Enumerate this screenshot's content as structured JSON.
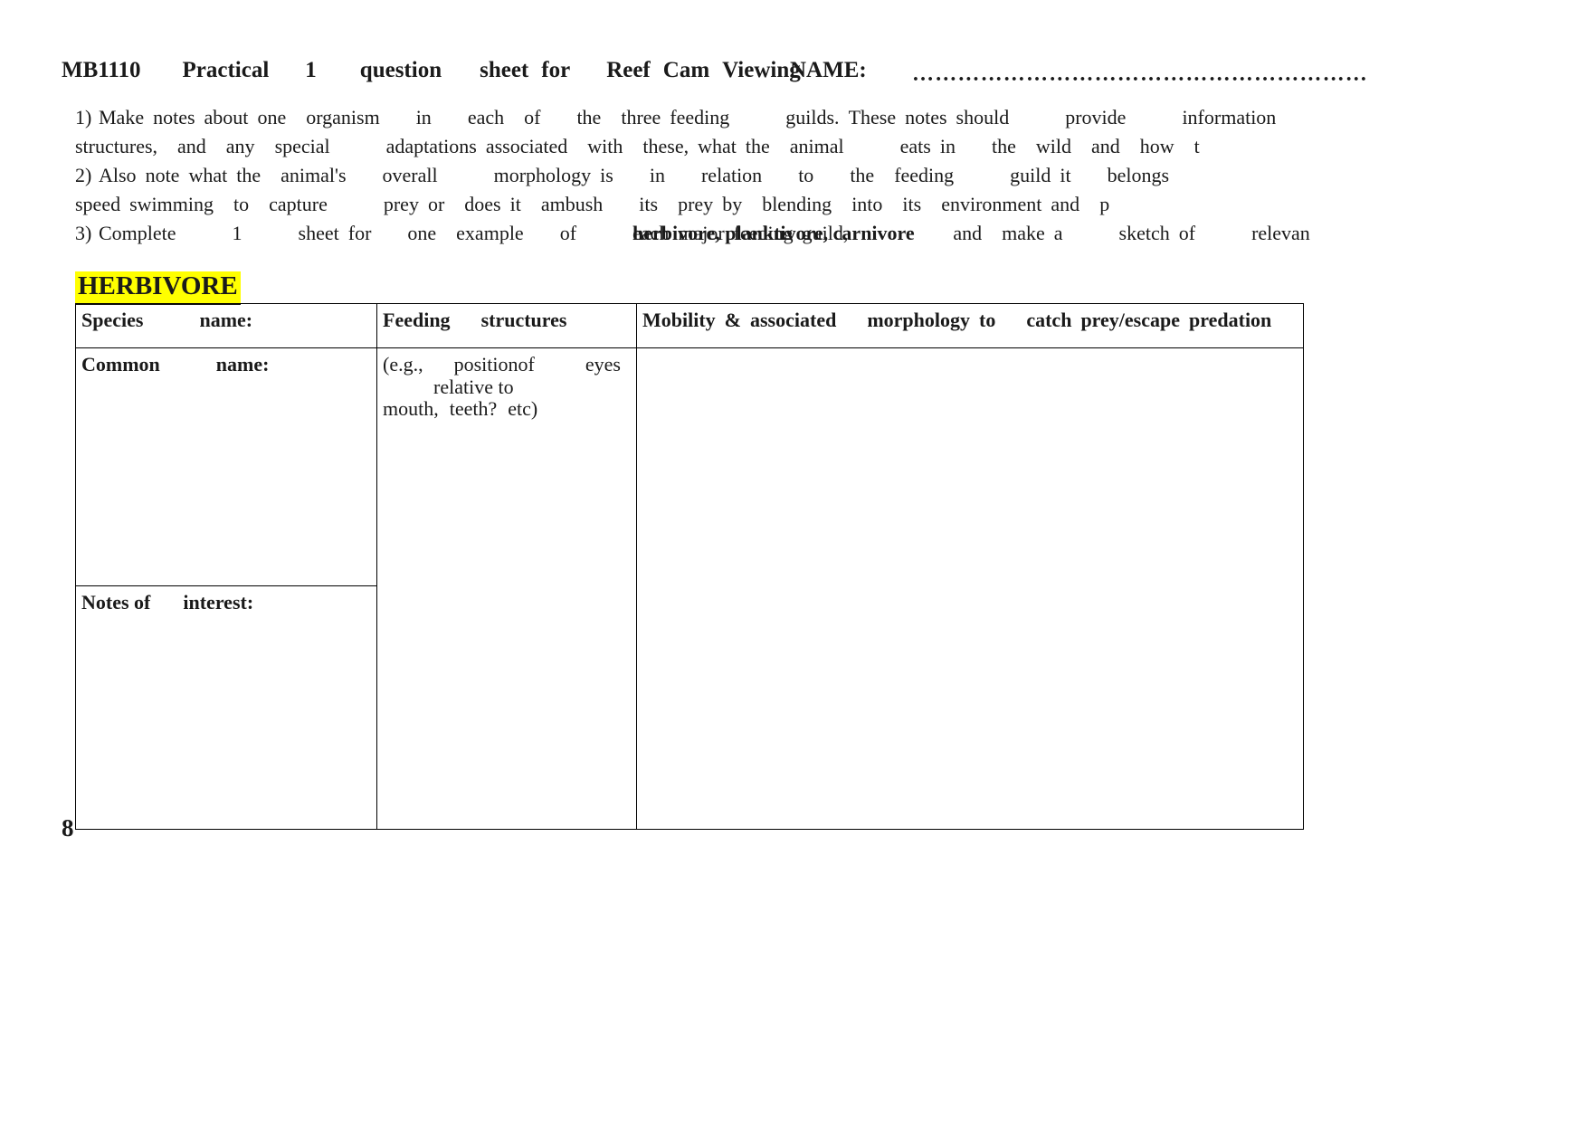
{
  "document": {
    "title_words": [
      "MB1110",
      "Practical",
      "1",
      "question",
      "sheet",
      "for",
      "Reef",
      "Cam",
      "Viewing"
    ],
    "title_full": "MB1110 Practical 1 question sheet for Reef Cam Viewing",
    "name_label": "NAME:",
    "name_dots": "……………………………………………………",
    "page_number": "8"
  },
  "instructions": {
    "item1": {
      "number": "1)",
      "line1_words": [
        "Make",
        "notes",
        "about",
        "one",
        "organism",
        "in",
        "each",
        "of",
        "the",
        "three",
        "feeding",
        "guilds.",
        "These",
        "notes",
        "should",
        "provide",
        "information"
      ],
      "line2_words": [
        "structures,",
        "and",
        "any",
        "special",
        "adaptations",
        "associated",
        "with",
        "these,",
        "what",
        "the",
        "animal",
        "eats",
        "in",
        "the",
        "wild",
        "and",
        "how",
        "t"
      ]
    },
    "item2": {
      "number": "2)",
      "line1_words": [
        "Also",
        "note",
        "what",
        "the",
        "animal's",
        "overall",
        "morphology",
        "is",
        "in",
        "relation",
        "to",
        "the",
        "feeding",
        "guild",
        "it",
        "belongs"
      ],
      "line2_words": [
        "speed",
        "swimming",
        "to",
        "capture",
        "prey",
        "or",
        "does",
        "it",
        "ambush",
        "its",
        "prey",
        "by",
        "blending",
        "into",
        "its",
        "environment",
        "and",
        "p"
      ]
    },
    "item3": {
      "number": "3)",
      "line1_words": [
        "Complete",
        "1",
        "sheet",
        "for",
        "one",
        "example",
        "of",
        "each",
        "major",
        "feeding",
        "guild,"
      ],
      "overlap_bold": "herbivore, planktivore, carnivore",
      "line1_tail_words": [
        "and",
        "make",
        "a",
        "sketch",
        "of",
        "relevan"
      ]
    }
  },
  "section": {
    "heading": "HERBIVORE"
  },
  "table": {
    "headers": {
      "species_name": "Species name:",
      "species_name_a": "Species",
      "species_name_b": "name:",
      "feeding_structures": "Feeding structures",
      "feeding_structures_a": "Feeding",
      "feeding_structures_b": "structures",
      "mobility": "Mobility & associated morphology to catch prey/escape predation",
      "mobility_a": "Mobility",
      "mobility_amp": "&",
      "mobility_b": "associated",
      "mobility_c": "morphology",
      "mobility_d": "to",
      "mobility_e": "catch",
      "mobility_f": "prey/escape",
      "mobility_g": "predation"
    },
    "rows": {
      "common_name_a": "Common",
      "common_name_b": "name:",
      "example_hint_line1_a": "(e.g.,",
      "example_hint_line1_b": "position",
      "example_hint_line1_c": "of",
      "example_hint_line1_d": "eyes",
      "example_hint_line1_e": "relative to",
      "example_hint_line2_a": "mouth,",
      "example_hint_line2_b": "teeth?",
      "example_hint_line2_c": "etc)",
      "notes_a": "Notes of",
      "notes_b": "interest:"
    }
  },
  "colors": {
    "highlight": "#ffff00",
    "text": "#1a1a1a",
    "border": "#000000"
  }
}
